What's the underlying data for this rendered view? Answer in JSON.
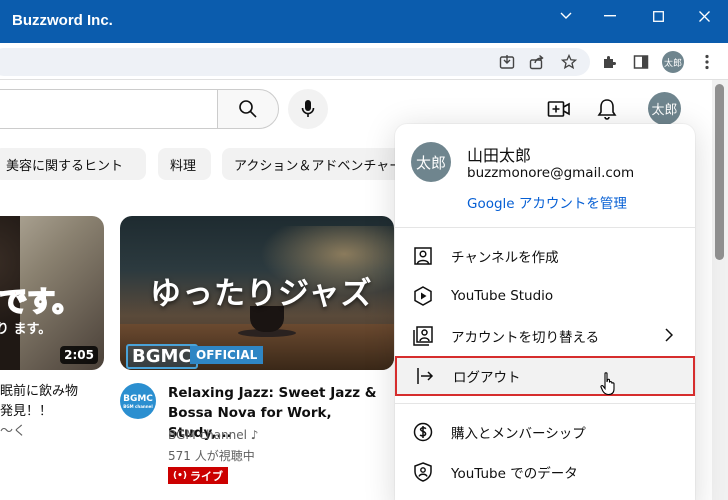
{
  "window": {
    "title": "Buzzword Inc."
  },
  "browser": {
    "profile_initials": "太郎"
  },
  "youtube": {
    "header_avatar": "太郎",
    "chips": [
      "美容に関するヒント",
      "料理",
      "アクション＆アドベンチャー"
    ],
    "videos": [
      {
        "thumb_text_red": "Eです。",
        "thumb_text_white": "り ます。",
        "duration": "2:05",
        "title_line1": "眠前に飲み物",
        "title_line2": "発見！！",
        "channel_partial": "〜く"
      },
      {
        "thumb_title": "ゆったりジャズ",
        "thumb_logo": "BGMC",
        "thumb_official": "OFFICIAL",
        "channel_avatar_line1": "BGMC",
        "channel_avatar_line2": "BGM channel",
        "title": "Relaxing Jazz: Sweet Jazz & Bossa Nova for Work, Study,...",
        "channel": "BGM channel ♪",
        "views": "571 人が視聴中",
        "live": "ライブ"
      }
    ]
  },
  "account_menu": {
    "avatar": "太郎",
    "name": "山田太郎",
    "email": "buzzmonore@gmail.com",
    "manage_link": "Google アカウントを管理",
    "items": [
      {
        "label": "チャンネルを作成",
        "icon": "person-box-icon"
      },
      {
        "label": "YouTube Studio",
        "icon": "studio-icon"
      },
      {
        "label": "アカウントを切り替える",
        "icon": "switch-account-icon"
      },
      {
        "label": "ログアウト",
        "icon": "sign-out-icon"
      },
      {
        "label": "購入とメンバーシップ",
        "icon": "dollar-icon"
      },
      {
        "label": "YouTube でのデータ",
        "icon": "shield-person-icon"
      }
    ]
  },
  "colors": {
    "titlebar": "#0b5cad",
    "link": "#065fd4",
    "highlight_border": "#d62d2d",
    "live_red": "#cc0000"
  }
}
